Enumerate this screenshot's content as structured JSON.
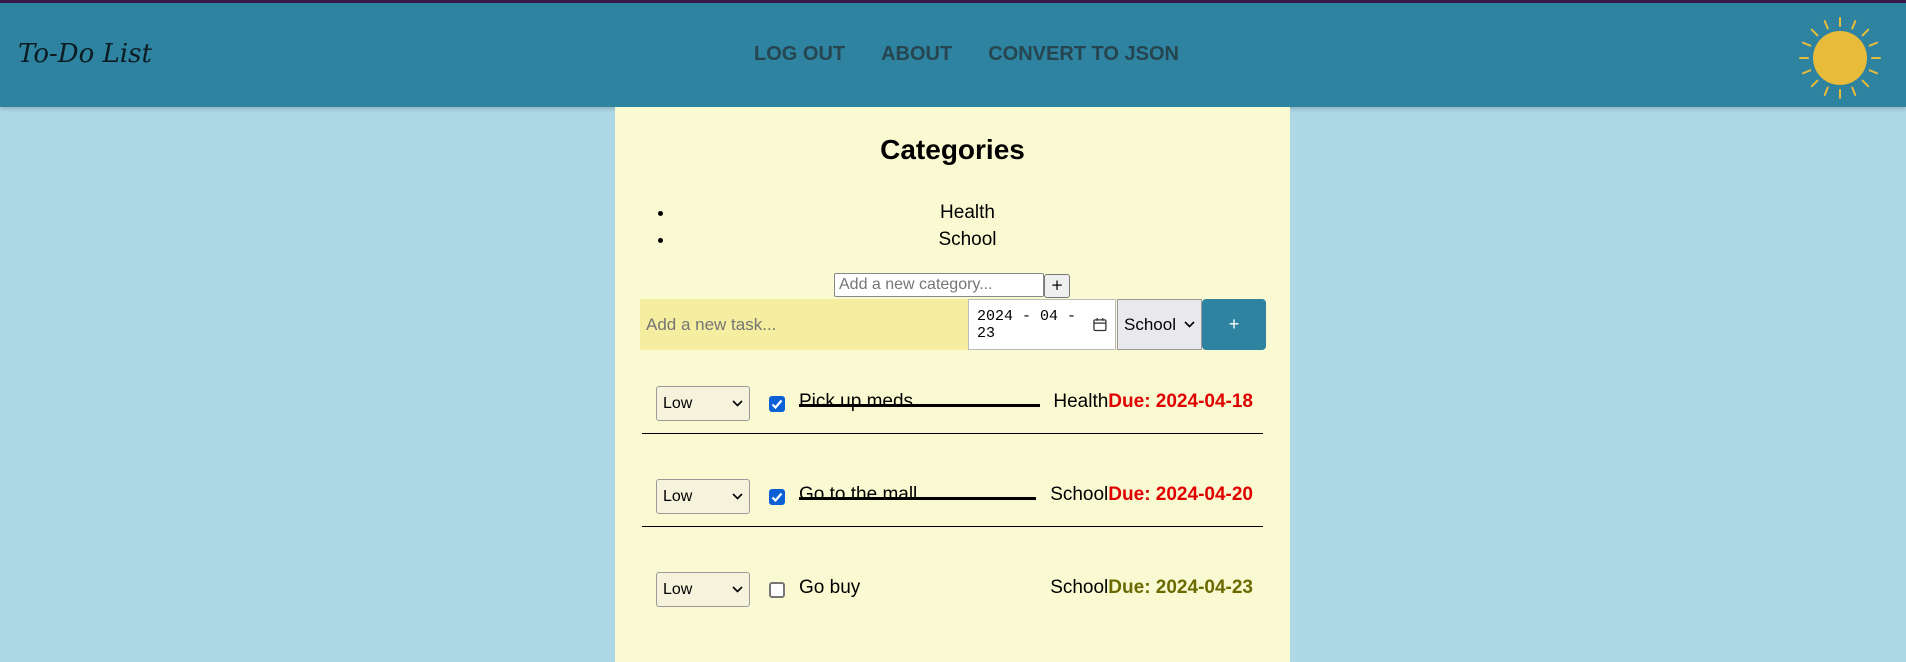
{
  "header": {
    "title": "To-Do List",
    "nav": [
      "LOG OUT",
      "ABOUT",
      "CONVERT TO JSON"
    ]
  },
  "categories": {
    "title": "Categories",
    "items": [
      "Health",
      "School"
    ],
    "input_placeholder": "Add a new category...",
    "add_label": "+"
  },
  "task_form": {
    "placeholder": "Add a new task...",
    "date": "2024 - 04 - 23",
    "category": "School",
    "add_label": "+"
  },
  "tasks": [
    {
      "priority": "Low",
      "done": true,
      "name": "Pick up meds",
      "category": "Health",
      "due": "Due: 2024-04-18",
      "due_color": "#e00000"
    },
    {
      "priority": "Low",
      "done": true,
      "name": "Go to the mall",
      "category": "School",
      "due": "Due: 2024-04-20",
      "due_color": "#e00000"
    },
    {
      "priority": "Low",
      "done": false,
      "name": "Go buy",
      "category": "School",
      "due": "Due: 2024-04-23",
      "due_color": "#6b6a00"
    }
  ],
  "colors": {
    "header_bg": "#2e83a1",
    "page_bg": "#add8e6",
    "panel_bg": "#fafad2",
    "sun": "#e8bb3b"
  }
}
